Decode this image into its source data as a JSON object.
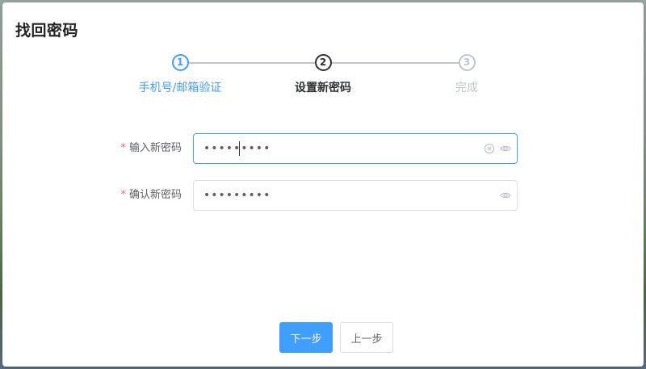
{
  "dialog": {
    "title": "找回密码"
  },
  "steps": [
    {
      "number": "1",
      "label": "手机号/邮箱验证",
      "status": "done"
    },
    {
      "number": "2",
      "label": "设置新密码",
      "status": "current"
    },
    {
      "number": "3",
      "label": "完成",
      "status": "pending"
    }
  ],
  "form": {
    "new_password": {
      "required_mark": "*",
      "label": "输入新密码",
      "value": "123456789"
    },
    "confirm_password": {
      "required_mark": "*",
      "label": "确认新密码",
      "value": "123456789"
    }
  },
  "buttons": {
    "next": "下一步",
    "prev": "上一步"
  },
  "icons": {
    "clear": "circle-close-icon",
    "toggle_visibility": "eye-icon"
  },
  "colors": {
    "primary": "#409eff",
    "active_step": "#303133",
    "pending_step": "#c0c4cc",
    "required": "#f56c6c"
  }
}
